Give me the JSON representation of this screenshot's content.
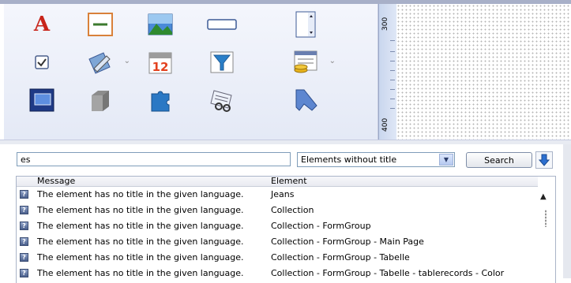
{
  "toolbox": {
    "tools": [
      {
        "icon": "text-tool-icon",
        "glyph": "A",
        "color": "#c8251b"
      },
      {
        "icon": "line-tool-icon"
      },
      {
        "icon": "image-tool-icon"
      },
      {
        "icon": "textfield-tool-icon"
      },
      {
        "icon": "listbox-tool-icon"
      },
      {
        "icon": "checkbox-tool-icon"
      },
      {
        "icon": "edit-tool-icon"
      },
      {
        "icon": "calendar-tool-icon",
        "glyph": "12"
      },
      {
        "icon": "filter-tool-icon"
      },
      {
        "icon": "database-tool-icon"
      },
      {
        "icon": "frame-tool-icon"
      },
      {
        "icon": "container-tool-icon"
      },
      {
        "icon": "plugin-tool-icon"
      },
      {
        "icon": "search-records-tool-icon"
      },
      {
        "icon": "bookmark-tool-icon"
      }
    ],
    "dropdown_arrow": "⌄"
  },
  "ruler": {
    "labels": [
      "300",
      "400"
    ]
  },
  "search": {
    "value": "es",
    "filter_selected": "Elements without title",
    "button_label": "Search"
  },
  "table": {
    "columns": {
      "message": "Message",
      "element": "Element"
    },
    "rows": [
      {
        "message": "The element has no title in the given language.",
        "element": "Jeans"
      },
      {
        "message": "The element has no title in the given language.",
        "element": "Collection"
      },
      {
        "message": "The element has no title in the given language.",
        "element": "Collection - FormGroup"
      },
      {
        "message": "The element has no title in the given language.",
        "element": "Collection - FormGroup - Main Page"
      },
      {
        "message": "The element has no title in the given language.",
        "element": "Collection - FormGroup - Tabelle"
      },
      {
        "message": "The element has no title in the given language.",
        "element": "Collection - FormGroup - Tabelle - tablerecords - Color"
      }
    ],
    "row_icon": "?"
  }
}
